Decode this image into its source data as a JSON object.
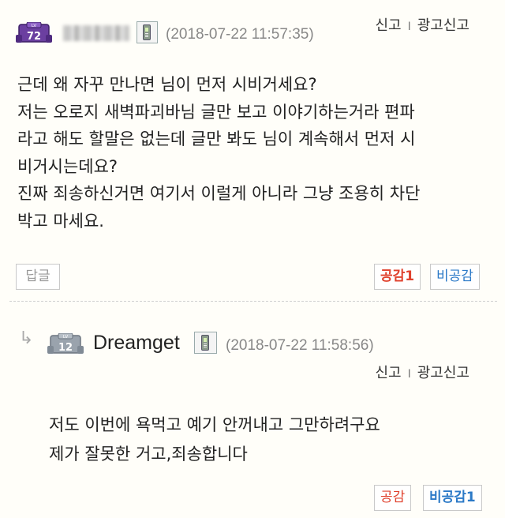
{
  "comments": [
    {
      "level": "72",
      "level_tag": "LV",
      "author_name": "",
      "author_blurred": true,
      "device_icon": "mobile-phone-icon",
      "datetime": "(2018-07-22 11:57:35)",
      "report_label": "신고",
      "ad_report_label": "광고신고",
      "separator": "I",
      "body": "근데 왜 자꾸 만나면 님이 먼저 시비거세요?\n저는 오로지 새벽파괴바님 글만 보고 이야기하는거라 편파\n라고 해도 할말은 없는데 글만 봐도 님이 계속해서 먼저 시\n비거시는데요?\n진짜 죄송하신거면 여기서 이럴게 아니라 그냥 조용히 차단\n박고 마세요.",
      "reply_label": "답글",
      "like_label": "공감1",
      "dislike_label": "비공감"
    },
    {
      "is_reply": true,
      "reply_arrow": "↳",
      "level": "12",
      "level_tag": "LV",
      "author_name": "Dreamget",
      "device_icon": "mobile-phone-icon",
      "datetime": "(2018-07-22 11:58:56)",
      "report_label": "신고",
      "ad_report_label": "광고신고",
      "separator": "I",
      "body": "저도 이번에 욕먹고 예기 안꺼내고 그만하려구요\n제가 잘못한 거고,죄송합니다",
      "like_label": "공감",
      "dislike_label": "비공감1"
    }
  ],
  "colors": {
    "like": "#e0412d",
    "dislike": "#2b79c7",
    "level_badge_purple": "#6b3fa0",
    "level_badge_grey": "#9aa3ad"
  }
}
